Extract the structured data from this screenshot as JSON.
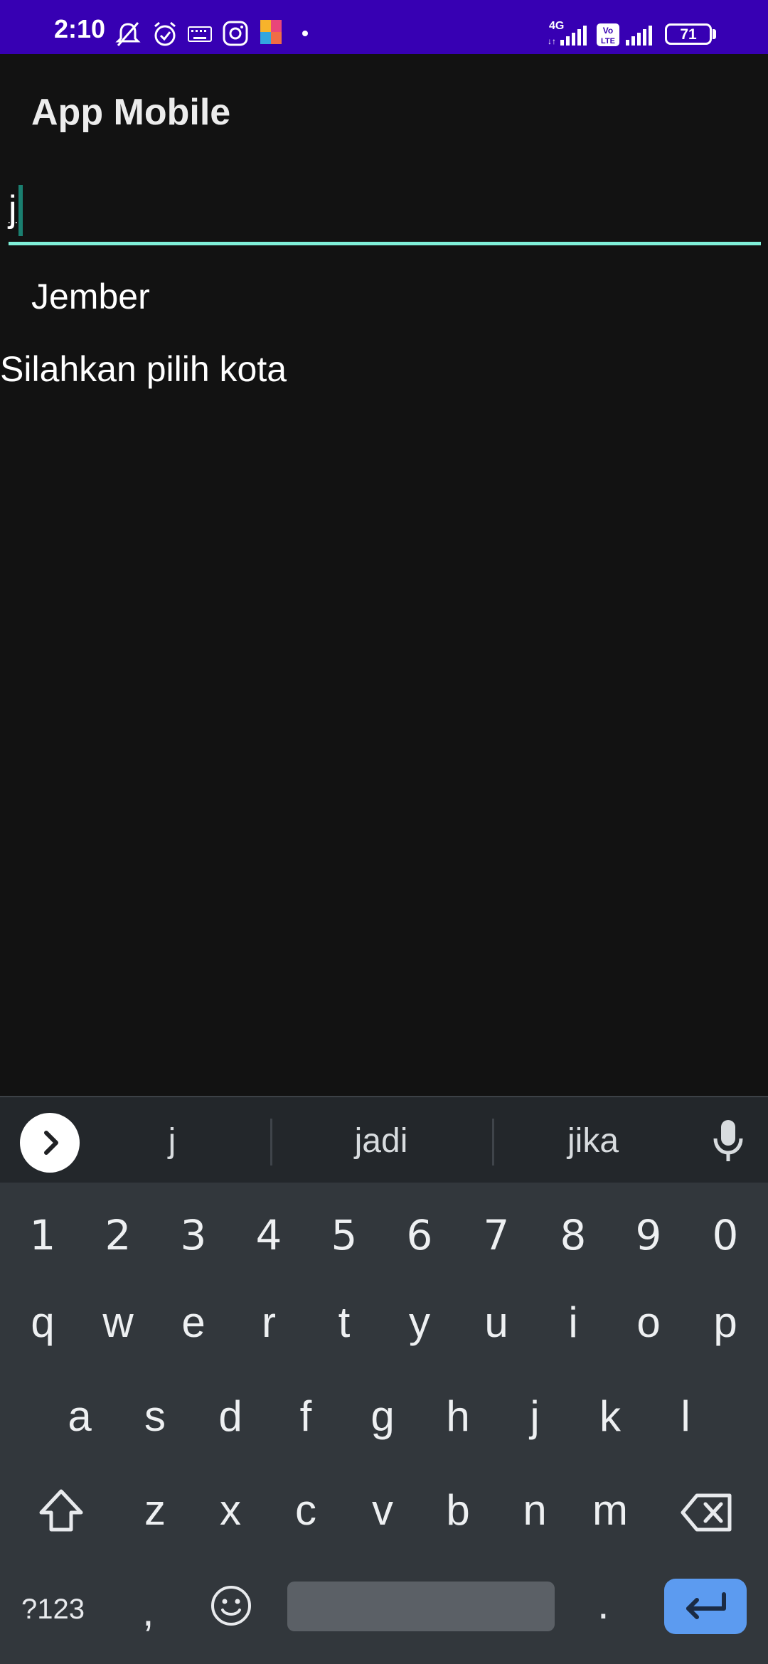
{
  "status_bar": {
    "time": "2:10",
    "network_type": "4G",
    "volte": "Vo LTE",
    "battery_level": "71",
    "icons": [
      "mute-notification-icon",
      "alarm-icon",
      "keyboard-icon",
      "instagram-icon",
      "app-colorful-icon",
      "dot-icon",
      "signal-icon",
      "signal-icon",
      "battery-icon"
    ]
  },
  "app": {
    "title": "App Mobile",
    "input_value": "j",
    "suggestion": "Jember",
    "prompt": "Silahkan pilih kota",
    "accent_color": "#7ff0d9"
  },
  "keyboard": {
    "suggestions": [
      "j",
      "jadi",
      "jika"
    ],
    "row_numbers": [
      "1",
      "2",
      "3",
      "4",
      "5",
      "6",
      "7",
      "8",
      "9",
      "0"
    ],
    "row1": [
      "q",
      "w",
      "e",
      "r",
      "t",
      "y",
      "u",
      "i",
      "o",
      "p"
    ],
    "row2": [
      "a",
      "s",
      "d",
      "f",
      "g",
      "h",
      "j",
      "k",
      "l"
    ],
    "row3": [
      "z",
      "x",
      "c",
      "v",
      "b",
      "n",
      "m"
    ],
    "symbols_label": "?123",
    "comma_label": ",",
    "period_label": ".",
    "enter_color": "#5c9bf0"
  }
}
